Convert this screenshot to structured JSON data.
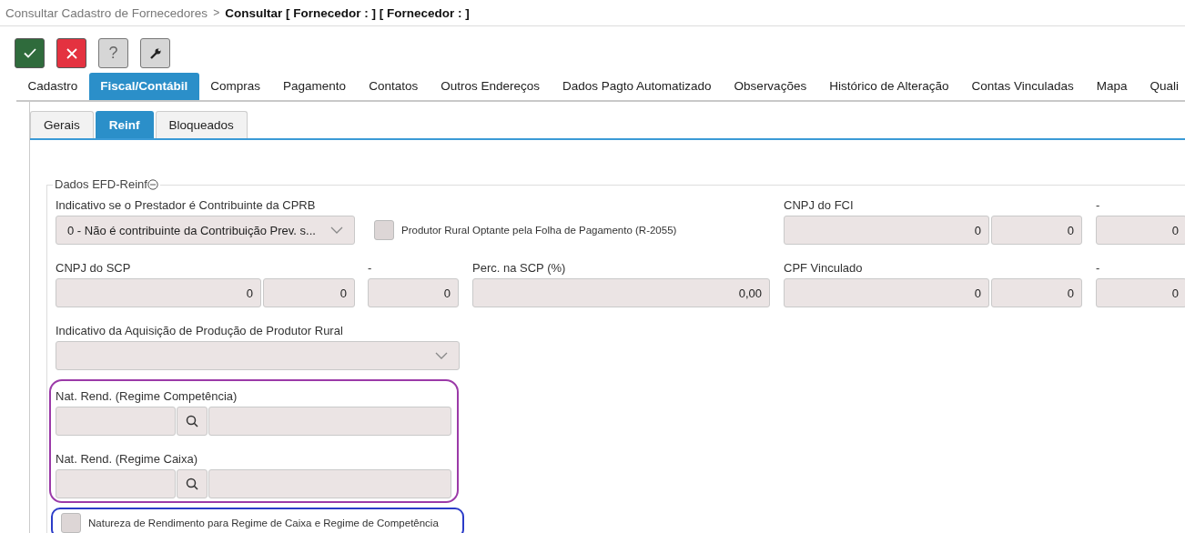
{
  "breadcrumb": {
    "parent": "Consultar Cadastro de Fornecedores",
    "separator": ">",
    "current": "Consultar [ Fornecedor : ] [ Fornecedor : ]"
  },
  "toolbar": [
    {
      "kind": "confirm"
    },
    {
      "kind": "cancel"
    },
    {
      "kind": "help",
      "label": "?"
    },
    {
      "kind": "tools"
    }
  ],
  "tabs": [
    {
      "label": "Cadastro",
      "selected": false
    },
    {
      "label": "Fiscal/Contábil",
      "selected": true
    },
    {
      "label": "Compras",
      "selected": false
    },
    {
      "label": "Pagamento",
      "selected": false
    },
    {
      "label": "Contatos",
      "selected": false
    },
    {
      "label": "Outros Endereços",
      "selected": false
    },
    {
      "label": "Dados Pagto Automatizado",
      "selected": false
    },
    {
      "label": "Observações",
      "selected": false
    },
    {
      "label": "Histórico de Alteração",
      "selected": false
    },
    {
      "label": "Contas Vinculadas",
      "selected": false
    },
    {
      "label": "Mapa",
      "selected": false
    },
    {
      "label": "Quali",
      "selected": false
    }
  ],
  "subtabs": [
    {
      "label": "Gerais",
      "selected": false
    },
    {
      "label": "Reinf",
      "selected": true
    },
    {
      "label": "Bloqueados",
      "selected": false
    }
  ],
  "section": {
    "title": "Dados EFD-Reinf",
    "expanded": true
  },
  "cprb": {
    "label": "Indicativo se o Prestador é Contribuinte da CPRB",
    "value": "0 - Não é contribuinte da Contribuição Prev. s..."
  },
  "produtor_rural": {
    "label": "Produtor Rural Optante pela Folha de Pagamento (R-2055)",
    "checked": false
  },
  "cnpj_fci": {
    "label": "CNPJ do FCI",
    "values": [
      "0",
      "0"
    ]
  },
  "fci_dv": {
    "label": "-",
    "value": "0"
  },
  "cnpj_scp": {
    "label": "CNPJ do SCP",
    "values": [
      "0",
      "0"
    ]
  },
  "scp_dv": {
    "label": "-",
    "value": "0"
  },
  "perc_scp": {
    "label": "Perc. na SCP (%)",
    "value": "0,00"
  },
  "cpf_vinculado": {
    "label": "CPF Vinculado",
    "values": [
      "0",
      "0"
    ]
  },
  "cpf_dv": {
    "label": "-",
    "value": "0"
  },
  "aquisicao": {
    "label": "Indicativo da Aquisição de Produção de Produtor Rural"
  },
  "nat_rend": [
    {
      "label": "Nat. Rend. (Regime Competência)"
    },
    {
      "label": "Nat. Rend. (Regime Caixa)"
    }
  ],
  "natureza": {
    "label": "Natureza de Rendimento para Regime de Caixa e Regime de Competência",
    "checked": false
  }
}
